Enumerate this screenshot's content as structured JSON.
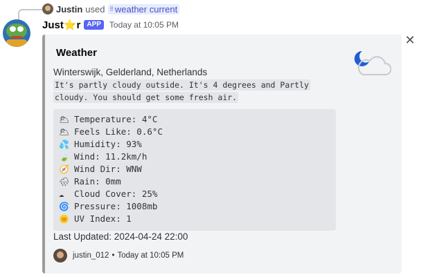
{
  "reply": {
    "user": "Justin",
    "used_text": "used",
    "command_icon": "slash-command-icon",
    "command": "weather current"
  },
  "message": {
    "bot_name": "Just⭐r",
    "badge": "APP",
    "timestamp": "Today at 10:05 PM"
  },
  "embed": {
    "title": "Weather",
    "thumbnail_icon": "moon-cloud-icon",
    "location": "Winterswijk, Gelderland, Netherlands",
    "description": "It's partly cloudy outside. It's 4 degrees and Partly cloudy. You should get some fresh air.",
    "details": [
      {
        "icon": "🌥",
        "text": "Temperature: 4°C"
      },
      {
        "icon": "🌥",
        "text": "Feels Like: 0.6°C"
      },
      {
        "icon": "💦",
        "text": "Humidity: 93%"
      },
      {
        "icon": "🍃",
        "text": "Wind: 11.2km/h"
      },
      {
        "icon": "🧭",
        "text": "Wind Dir: WNW"
      },
      {
        "icon": "🌧",
        "text": "Rain: 0mm"
      },
      {
        "icon": "☁",
        "text": "Cloud Cover: 25%"
      },
      {
        "icon": "🌀",
        "text": "Pressure: 1008mb"
      },
      {
        "icon": "🌞",
        "text": "UV Index: 1"
      }
    ],
    "last_updated": "Last Updated: 2024-04-24 22:00",
    "footer_user": "justin_012",
    "footer_sep": "•",
    "footer_time": "Today at 10:05 PM",
    "accent_color": "#9c9c9c"
  },
  "close_icon": "close-icon"
}
